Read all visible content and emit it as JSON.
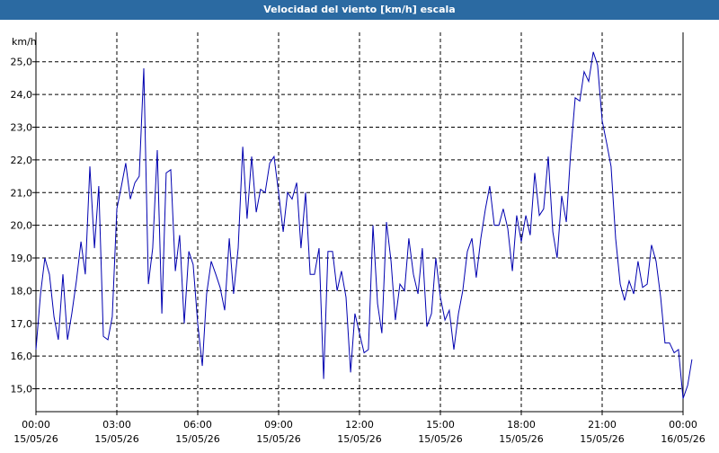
{
  "window": {
    "title": "Velocidad del viento [km/h] escala"
  },
  "chart_data": {
    "type": "line",
    "title": "Velocidad del viento [km/h] escala",
    "ylabel": "km/h",
    "xlabel": "",
    "ylim": [
      14.3,
      25.9
    ],
    "xlim_hours": [
      0,
      24
    ],
    "grid": true,
    "line_color": "#0000b0",
    "y_ticks": [
      "15,0",
      "16,0",
      "17,0",
      "18,0",
      "19,0",
      "20,0",
      "21,0",
      "22,0",
      "23,0",
      "24,0",
      "25,0"
    ],
    "x_ticks": [
      {
        "time": "00:00",
        "date": "15/05/26"
      },
      {
        "time": "03:00",
        "date": "15/05/26"
      },
      {
        "time": "06:00",
        "date": "15/05/26"
      },
      {
        "time": "09:00",
        "date": "15/05/26"
      },
      {
        "time": "12:00",
        "date": "15/05/26"
      },
      {
        "time": "15:00",
        "date": "15/05/26"
      },
      {
        "time": "18:00",
        "date": "15/05/26"
      },
      {
        "time": "21:00",
        "date": "15/05/26"
      },
      {
        "time": "00:00",
        "date": "16/05/26"
      }
    ],
    "series": [
      {
        "values": [
          [
            0.0,
            16.2
          ],
          [
            0.17,
            17.9
          ],
          [
            0.33,
            19.0
          ],
          [
            0.5,
            18.5
          ],
          [
            0.67,
            17.2
          ],
          [
            0.83,
            16.5
          ],
          [
            1.0,
            18.5
          ],
          [
            1.17,
            16.5
          ],
          [
            1.33,
            17.3
          ],
          [
            1.5,
            18.3
          ],
          [
            1.67,
            19.5
          ],
          [
            1.83,
            18.5
          ],
          [
            2.0,
            21.8
          ],
          [
            2.17,
            19.3
          ],
          [
            2.33,
            21.2
          ],
          [
            2.5,
            16.6
          ],
          [
            2.67,
            16.5
          ],
          [
            2.83,
            17.2
          ],
          [
            3.0,
            20.5
          ],
          [
            3.17,
            21.2
          ],
          [
            3.33,
            21.9
          ],
          [
            3.5,
            20.8
          ],
          [
            3.67,
            21.3
          ],
          [
            3.83,
            21.5
          ],
          [
            4.0,
            24.8
          ],
          [
            4.17,
            18.2
          ],
          [
            4.33,
            19.3
          ],
          [
            4.5,
            22.3
          ],
          [
            4.67,
            17.3
          ],
          [
            4.83,
            21.6
          ],
          [
            5.0,
            21.7
          ],
          [
            5.17,
            18.6
          ],
          [
            5.33,
            19.7
          ],
          [
            5.5,
            17.0
          ],
          [
            5.67,
            19.2
          ],
          [
            5.83,
            18.8
          ],
          [
            6.0,
            17.0
          ],
          [
            6.17,
            15.7
          ],
          [
            6.33,
            17.9
          ],
          [
            6.5,
            18.9
          ],
          [
            6.67,
            18.5
          ],
          [
            6.83,
            18.1
          ],
          [
            7.0,
            17.4
          ],
          [
            7.17,
            19.6
          ],
          [
            7.33,
            17.9
          ],
          [
            7.5,
            19.3
          ],
          [
            7.67,
            22.4
          ],
          [
            7.83,
            20.2
          ],
          [
            8.0,
            22.1
          ],
          [
            8.17,
            20.4
          ],
          [
            8.33,
            21.1
          ],
          [
            8.5,
            21.0
          ],
          [
            8.67,
            21.9
          ],
          [
            8.83,
            22.1
          ],
          [
            9.0,
            21.0
          ],
          [
            9.17,
            19.8
          ],
          [
            9.33,
            21.0
          ],
          [
            9.5,
            20.8
          ],
          [
            9.67,
            21.3
          ],
          [
            9.83,
            19.3
          ],
          [
            10.0,
            21.0
          ],
          [
            10.17,
            18.5
          ],
          [
            10.33,
            18.5
          ],
          [
            10.5,
            19.3
          ],
          [
            10.67,
            15.3
          ],
          [
            10.83,
            19.2
          ],
          [
            11.0,
            19.2
          ],
          [
            11.17,
            18.0
          ],
          [
            11.33,
            18.6
          ],
          [
            11.5,
            17.8
          ],
          [
            11.67,
            15.5
          ],
          [
            11.83,
            17.3
          ],
          [
            12.0,
            16.7
          ],
          [
            12.17,
            16.1
          ],
          [
            12.33,
            16.2
          ],
          [
            12.5,
            20.0
          ],
          [
            12.67,
            17.6
          ],
          [
            12.83,
            16.7
          ],
          [
            13.0,
            20.1
          ],
          [
            13.17,
            18.9
          ],
          [
            13.33,
            17.1
          ],
          [
            13.5,
            18.2
          ],
          [
            13.67,
            18.0
          ],
          [
            13.83,
            19.6
          ],
          [
            14.0,
            18.5
          ],
          [
            14.17,
            17.9
          ],
          [
            14.33,
            19.3
          ],
          [
            14.5,
            16.9
          ],
          [
            14.67,
            17.3
          ],
          [
            14.83,
            19.0
          ],
          [
            15.0,
            17.8
          ],
          [
            15.17,
            17.1
          ],
          [
            15.33,
            17.4
          ],
          [
            15.5,
            16.2
          ],
          [
            15.67,
            17.3
          ],
          [
            15.83,
            18.0
          ],
          [
            16.0,
            19.2
          ],
          [
            16.17,
            19.6
          ],
          [
            16.33,
            18.4
          ],
          [
            16.5,
            19.6
          ],
          [
            16.67,
            20.5
          ],
          [
            16.83,
            21.2
          ],
          [
            17.0,
            20.0
          ],
          [
            17.17,
            20.0
          ],
          [
            17.33,
            20.5
          ],
          [
            17.5,
            19.9
          ],
          [
            17.67,
            18.6
          ],
          [
            17.83,
            20.3
          ],
          [
            18.0,
            19.5
          ],
          [
            18.17,
            20.3
          ],
          [
            18.33,
            19.7
          ],
          [
            18.5,
            21.6
          ],
          [
            18.67,
            20.3
          ],
          [
            18.83,
            20.5
          ],
          [
            19.0,
            22.1
          ],
          [
            19.17,
            19.8
          ],
          [
            19.33,
            19.0
          ],
          [
            19.5,
            20.9
          ],
          [
            19.67,
            20.1
          ],
          [
            19.83,
            22.2
          ],
          [
            20.0,
            23.9
          ],
          [
            20.17,
            23.8
          ],
          [
            20.33,
            24.7
          ],
          [
            20.5,
            24.4
          ],
          [
            20.67,
            25.3
          ],
          [
            20.83,
            24.9
          ],
          [
            21.0,
            23.2
          ],
          [
            21.17,
            22.5
          ],
          [
            21.33,
            21.8
          ],
          [
            21.5,
            19.6
          ],
          [
            21.67,
            18.2
          ],
          [
            21.83,
            17.7
          ],
          [
            22.0,
            18.3
          ],
          [
            22.17,
            17.9
          ],
          [
            22.33,
            18.9
          ],
          [
            22.5,
            18.1
          ],
          [
            22.67,
            18.2
          ],
          [
            22.83,
            19.4
          ],
          [
            23.0,
            18.9
          ],
          [
            23.17,
            17.8
          ],
          [
            23.33,
            16.4
          ],
          [
            23.5,
            16.4
          ],
          [
            23.67,
            16.1
          ],
          [
            23.83,
            16.2
          ],
          [
            24.0,
            14.7
          ],
          [
            24.17,
            15.1
          ],
          [
            24.33,
            15.9
          ]
        ]
      }
    ]
  }
}
